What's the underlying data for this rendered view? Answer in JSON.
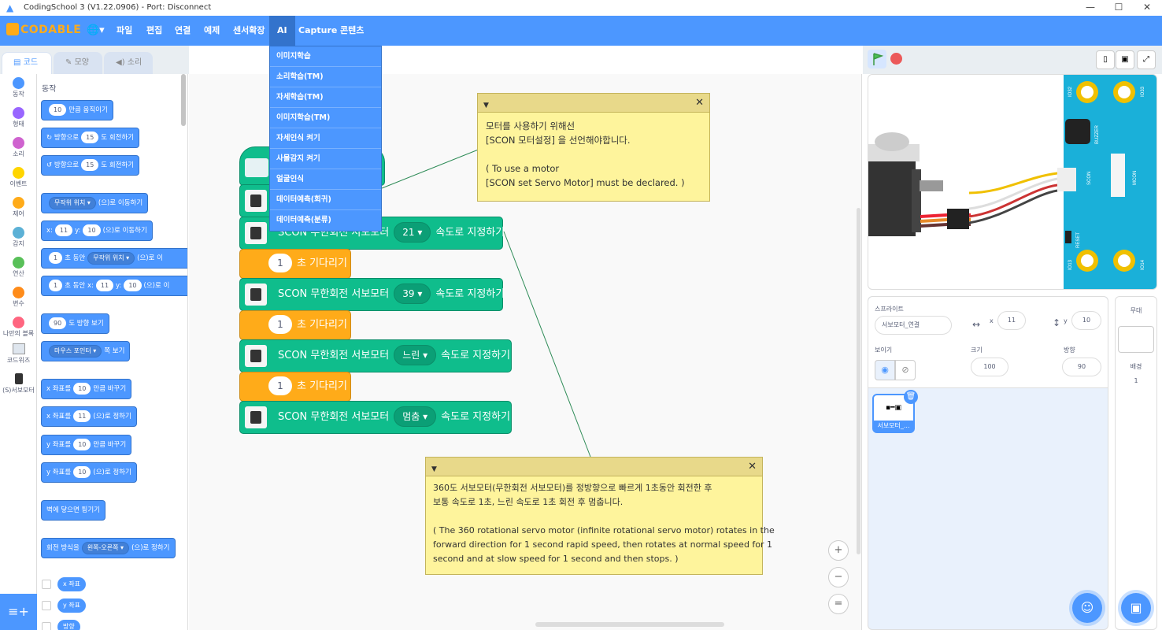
{
  "window": {
    "title": "CodingSchool 3 (V1.22.0906) - Port: Disconnect",
    "min": "—",
    "max": "☐",
    "close": "✕"
  },
  "menubar": {
    "brand": "CODABLE",
    "globe": "🌐▾",
    "items": [
      "파일",
      "편집",
      "연결",
      "예제",
      "센서확장",
      "AI",
      "Capture",
      "콘텐츠"
    ],
    "active": "AI"
  },
  "ai_menu": [
    "이미지학습",
    "소리학습(TM)",
    "자세학습(TM)",
    "이미지학습(TM)",
    "자세인식 켜기",
    "사물감지 켜기",
    "얼굴인식",
    "데이터예측(회귀)",
    "데이터예측(분류)"
  ],
  "tabs": [
    "코드",
    "모양",
    "소리"
  ],
  "categories": [
    {
      "label": "동작",
      "color": "#4c97ff"
    },
    {
      "label": "형태",
      "color": "#9966ff"
    },
    {
      "label": "소리",
      "color": "#cf63cf"
    },
    {
      "label": "이벤트",
      "color": "#ffd500"
    },
    {
      "label": "제어",
      "color": "#ffab19"
    },
    {
      "label": "감지",
      "color": "#5cb1d6"
    },
    {
      "label": "연산",
      "color": "#59c059"
    },
    {
      "label": "변수",
      "color": "#ff8c1a"
    },
    {
      "label": "나만의 블록",
      "color": "#ff6680"
    },
    {
      "label": "코드위즈",
      "color": "#ccc"
    },
    {
      "label": "(S)서보모터",
      "color": "#333"
    }
  ],
  "palette": {
    "heading": "동작",
    "blocks": [
      {
        "pre": "",
        "in": "10",
        "post": "만큼 움직이기"
      },
      {
        "pre": "↻ 방향으로",
        "in": "15",
        "post": "도 회전하기"
      },
      {
        "pre": "↺ 방향으로",
        "in": "15",
        "post": "도 회전하기"
      },
      {
        "pre": "",
        "drop": "무작위 위치",
        "post": "(으)로 이동하기"
      },
      {
        "pre": "x:",
        "in": "11",
        "mid": "y:",
        "in2": "10",
        "post": "(으)로 이동하기"
      },
      {
        "pre": "",
        "in": "1",
        "mid": "초 동안",
        "drop": "무작위 위치",
        "post": "(으)로 이"
      },
      {
        "pre": "",
        "in": "1",
        "mid": "초 동안 x:",
        "in2": "11",
        "mid2": "y:",
        "in3": "10",
        "post": "(으)로 이"
      },
      {
        "pre": "",
        "in": "90",
        "post": "도 방향 보기"
      },
      {
        "pre": "",
        "drop": "마우스 포인터",
        "post": "쪽 보기"
      },
      {
        "pre": "x 좌표를",
        "in": "10",
        "post": "만큼 바꾸기"
      },
      {
        "pre": "x 좌표를",
        "in": "11",
        "post": "(으)로 정하기"
      },
      {
        "pre": "y 좌표를",
        "in": "10",
        "post": "만큼 바꾸기"
      },
      {
        "pre": "y 좌표를",
        "in": "10",
        "post": "(으)로 정하기"
      },
      {
        "pre": "벽에 닿으면 튕기기"
      },
      {
        "pre": "회전 방식을",
        "drop": "왼쪽-오른쪽",
        "post": "(으)로 정하기"
      }
    ],
    "reporters": [
      "x 좌표",
      "y 좌표",
      "방향"
    ]
  },
  "script": [
    {
      "kind": "servo",
      "label": "SCON 무한회전 서보모터",
      "value": "21",
      "post": "속도로 지정하기"
    },
    {
      "kind": "wait",
      "value": "1",
      "label": "초 기다리기"
    },
    {
      "kind": "servo",
      "label": "SCON 무한회전 서보모터",
      "value": "39",
      "post": "속도로 지정하기"
    },
    {
      "kind": "wait",
      "value": "1",
      "label": "초 기다리기"
    },
    {
      "kind": "servo",
      "label": "SCON 무한회전 서보모터",
      "value": "느린",
      "post": "속도로 지정하기"
    },
    {
      "kind": "wait",
      "value": "1",
      "label": "초 기다리기"
    },
    {
      "kind": "servo",
      "label": "SCON 무한회전 서보모터",
      "value": "멈춤",
      "post": "속도로 지정하기"
    }
  ],
  "notes": [
    {
      "lines": [
        "모터를 사용하기 위해선",
        "[SCON 모터설정] 을 선언해야합니다.",
        "",
        "( To use a motor",
        "[SCON set Servo Motor] must be declared. )"
      ]
    },
    {
      "lines": [
        "360도 서보모터(무한회전 서보모터)를 정방향으로 빠르게 1초동안 회전한 후",
        "보통 속도로 1초, 느린 속도로 1초 회전 후 멈춥니다.",
        "",
        "( The 360 rotational servo motor (infinite rotational servo motor) rotates in the",
        "forward direction for 1 second rapid speed, then rotates at normal speed for 1",
        "second and at slow speed for 1 second and then stops. )"
      ]
    }
  ],
  "zoom": {
    "in": "+",
    "out": "−",
    "reset": "="
  },
  "board_labels": [
    "IO32",
    "IO33",
    "BUZZER",
    "SCON",
    "MCON",
    "RESET",
    "IO13",
    "IO14"
  ],
  "sprite": {
    "label": "스프라이트",
    "name": "서보모터_연결",
    "x_label": "x",
    "x": "11",
    "y_label": "y",
    "y": "10",
    "show_label": "보이기",
    "size_label": "크기",
    "size": "100",
    "dir_label": "방향",
    "direction": "90",
    "thumb": "서보모터_..."
  },
  "stage_panel": {
    "title": "무대",
    "backdrop_label": "배경",
    "backdrop_count": "1"
  }
}
